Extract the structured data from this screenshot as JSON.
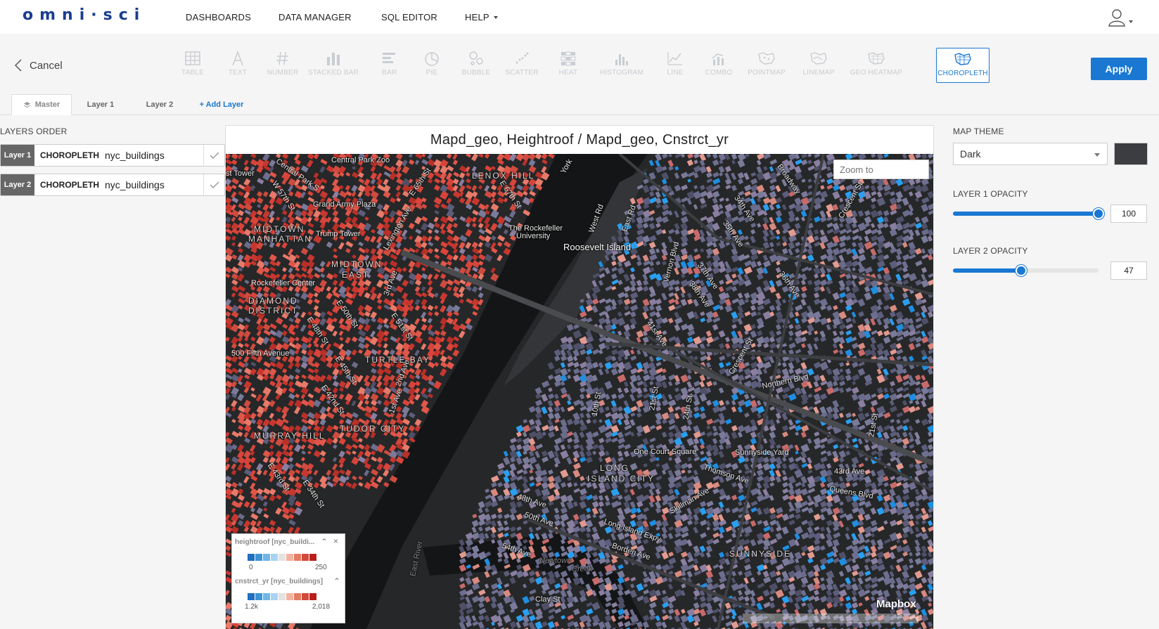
{
  "app": {
    "logo_text": "omni·sci"
  },
  "nav": {
    "items": [
      "DASHBOARDS",
      "DATA MANAGER",
      "SQL EDITOR",
      "HELP"
    ]
  },
  "toolbar": {
    "cancel_label": "Cancel",
    "apply_label": "Apply",
    "chart_types": [
      {
        "label": "TABLE",
        "icon": "table-icon"
      },
      {
        "label": "TEXT",
        "icon": "text-icon"
      },
      {
        "label": "NUMBER",
        "icon": "number-icon"
      },
      {
        "label": "STACKED BAR",
        "icon": "stacked-bar-icon"
      },
      {
        "label": "BAR",
        "icon": "bar-icon"
      },
      {
        "label": "PIE",
        "icon": "pie-icon"
      },
      {
        "label": "BUBBLE",
        "icon": "bubble-icon"
      },
      {
        "label": "SCATTER",
        "icon": "scatter-icon"
      },
      {
        "label": "HEAT",
        "icon": "heat-icon"
      },
      {
        "label": "HISTOGRAM",
        "icon": "histogram-icon"
      },
      {
        "label": "LINE",
        "icon": "line-icon"
      },
      {
        "label": "COMBO",
        "icon": "combo-icon"
      },
      {
        "label": "POINTMAP",
        "icon": "pointmap-icon"
      },
      {
        "label": "LINEMAP",
        "icon": "linemap-icon"
      },
      {
        "label": "GEO HEATMAP",
        "icon": "geo-heatmap-icon"
      },
      {
        "label": "CHOROPLETH",
        "icon": "choropleth-icon",
        "active": true
      }
    ]
  },
  "tabs": {
    "master": "Master",
    "layer1": "Layer 1",
    "layer2": "Layer 2",
    "add": "+ Add Layer"
  },
  "layers": {
    "title": "LAYERS ORDER",
    "rows": [
      {
        "badge": "Layer 1",
        "type": "CHOROPLETH",
        "table": "nyc_buildings"
      },
      {
        "badge": "Layer 2",
        "type": "CHOROPLETH",
        "table": "nyc_buildings"
      }
    ]
  },
  "chart": {
    "title": "Mapd_geo,  Heightroof / Mapd_geo,  Cnstrct_yr",
    "zoom_placeholder": "Zoom to",
    "attribution": "Mapbox",
    "map_labels": [
      "Central Park Zoo",
      "LENOX HILL",
      "Grand Army Plaza",
      "MIDTOWN",
      "MANHATTAN",
      "Trump Tower",
      "The Rockefeller",
      "University",
      "Roosevelt Island",
      "MIDTOWN",
      "EAST",
      "Rockefeller Center",
      "DIAMOND",
      "DISTRICT",
      "500 Fifth Avenue",
      "TURTLE BAY",
      "MURRAY HILL",
      "TUDOR CITY",
      "Northern Blvd",
      "One Court Square",
      "Sunnyside Yard",
      "LONG",
      "ISLAND CITY",
      "Thomson Ave",
      "Queens Blvd",
      "Long Island Expy",
      "Borden Ave",
      "SUNNYSIDE",
      "Clay St",
      "East River",
      "Newtown",
      "Creek",
      "st Tower",
      "Skillman Ave",
      "Broadway",
      "34th Ave",
      "35th Ave",
      "36th Ave",
      "37th Ave",
      "38th Ave",
      "41st Ave",
      "Crescent St",
      "21st St",
      "24th St",
      "Vernon Blvd",
      "43rd Ave",
      "48th Ave",
      "50th Ave",
      "54th Ave",
      "E 65th St",
      "E 67th St",
      "E 50th St",
      "E 48th St",
      "E 45th St",
      "E 42nd St",
      "E 51st St",
      "Lexington Ave",
      "3rd Ave",
      "2nd Ave",
      "1st Ave",
      "W 57th St",
      "Central Park S",
      "E 34th St",
      "E 43rd St",
      "Crescent St",
      "York",
      "West Rd",
      "East Rd",
      "21st St",
      "10th St"
    ]
  },
  "legend": {
    "layer1_title": "heightroof [nyc_buildi...",
    "layer1_min": "0",
    "layer1_max": "250",
    "layer2_title": "cnstrct_yr [nyc_buildings]",
    "layer2_min": "1.2k",
    "layer2_max": "2,018",
    "colors": [
      "#1f6fc0",
      "#3d94d6",
      "#71b6e8",
      "#a9d3f0",
      "#e3e3e3",
      "#f1b39f",
      "#e57c64",
      "#d24a3b",
      "#b8201c"
    ]
  },
  "right_panel": {
    "theme_label": "MAP THEME",
    "theme_value": "Dark",
    "layer1_opacity_label": "LAYER 1 OPACITY",
    "layer1_opacity_value": "100",
    "layer1_opacity": 1.0,
    "layer2_opacity_label": "LAYER 2 OPACITY",
    "layer2_opacity_value": "47",
    "layer2_opacity": 0.47
  },
  "colors": {
    "accent": "#1a78d2",
    "logo": "#1a3d8f",
    "map_bg": "#262728",
    "building_red": "#d9443a",
    "building_blue": "#1f8ee0",
    "building_purple": "#6b6c8c"
  }
}
